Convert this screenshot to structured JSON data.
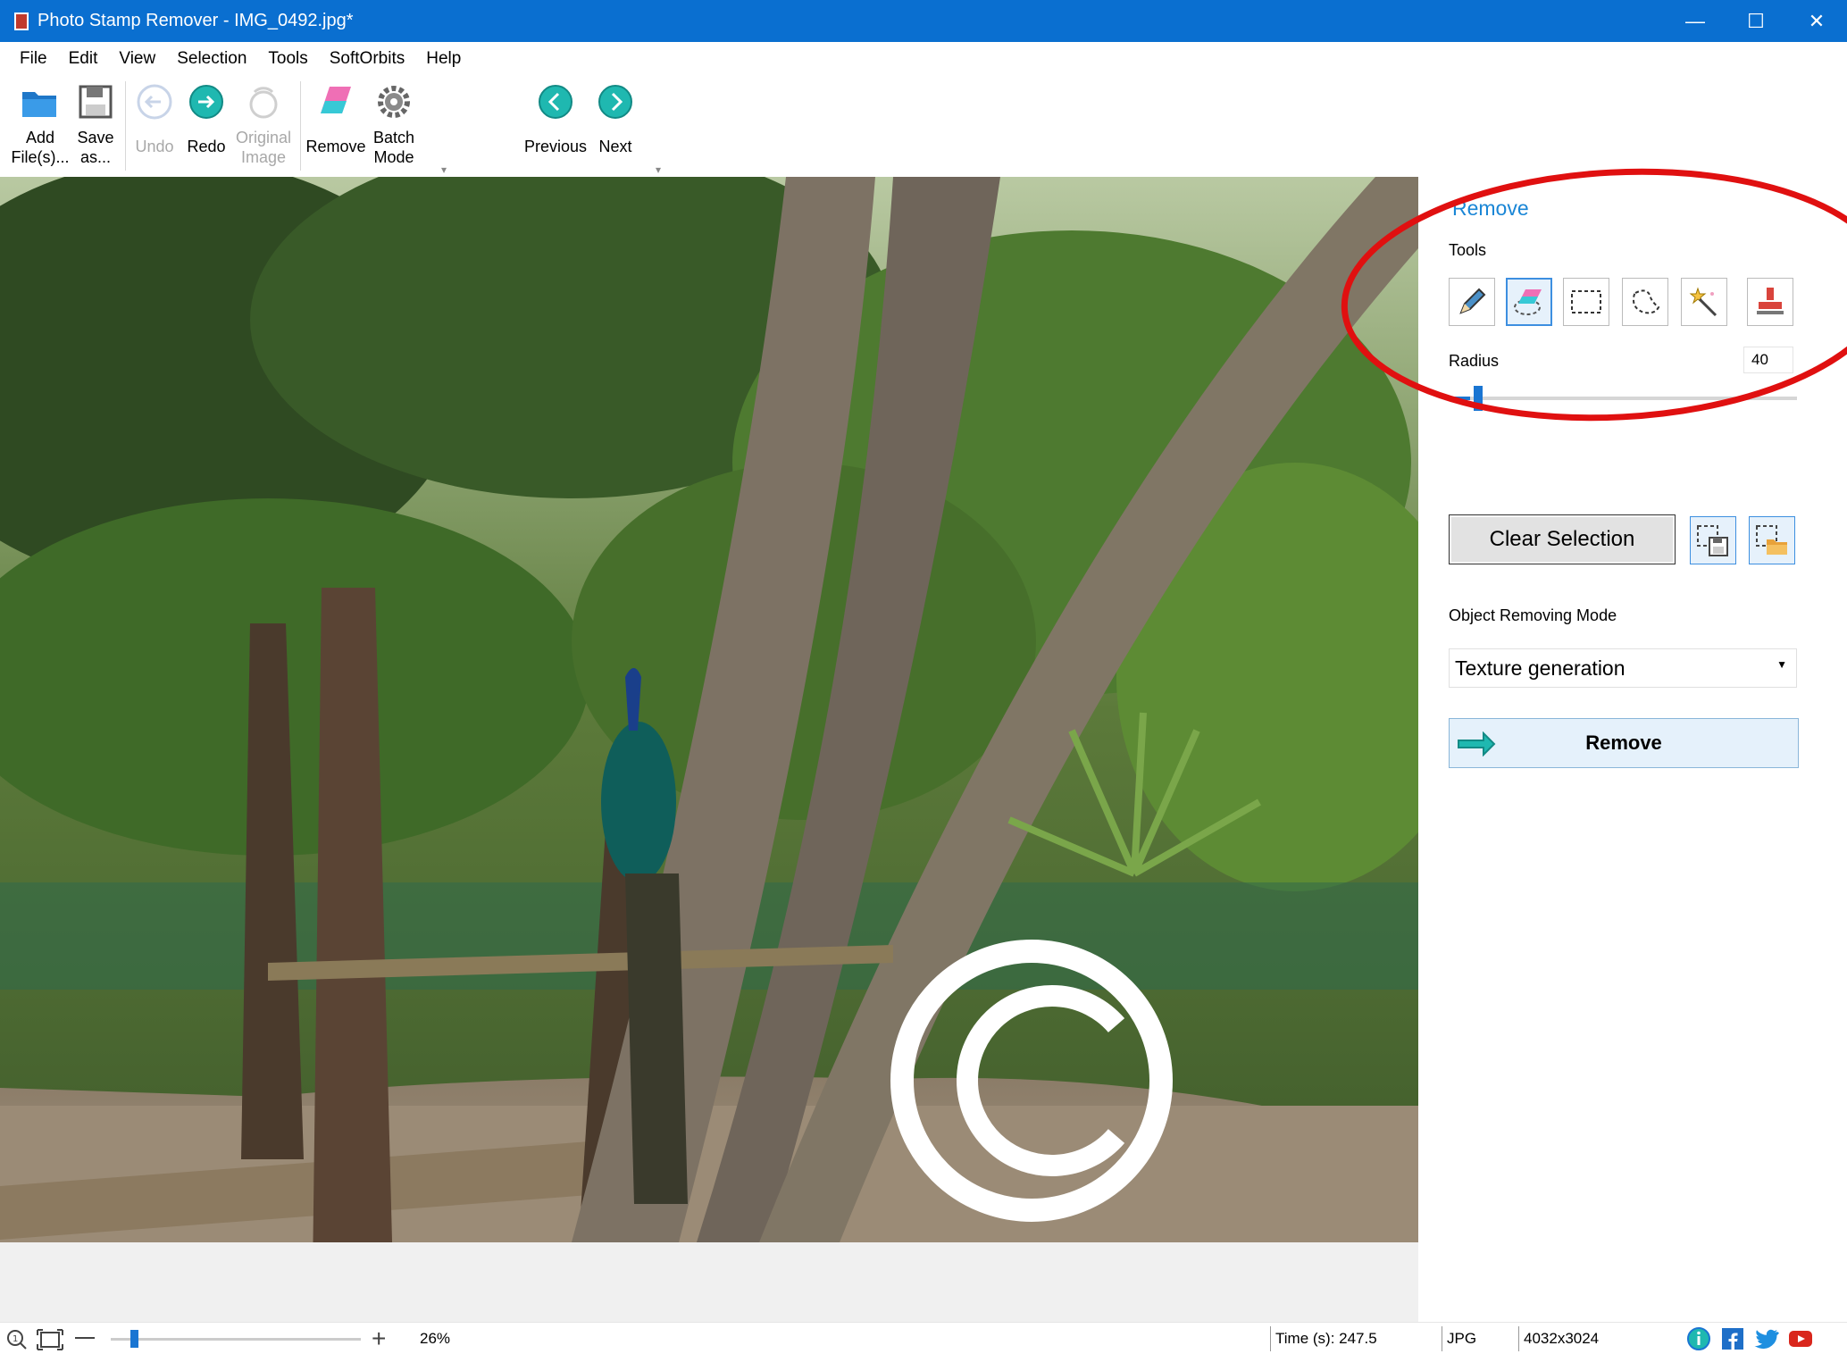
{
  "window": {
    "title": "Photo Stamp Remover - IMG_0492.jpg*",
    "minimize_glyph": "—",
    "maximize_glyph": "☐",
    "close_glyph": "✕"
  },
  "menu": [
    "File",
    "Edit",
    "View",
    "Selection",
    "Tools",
    "SoftOrbits",
    "Help"
  ],
  "toolbar": {
    "add_line1": "Add",
    "add_line2": "File(s)...",
    "save_line1": "Save",
    "save_line2": "as...",
    "undo": "Undo",
    "redo": "Redo",
    "original_line1": "Original",
    "original_line2": "Image",
    "remove": "Remove",
    "batch_line1": "Batch",
    "batch_line2": "Mode",
    "previous": "Previous",
    "next": "Next"
  },
  "panel": {
    "title": "Remove",
    "tools_label": "Tools",
    "tools": [
      "pencil-icon",
      "eraser-icon",
      "rect-select-icon",
      "lasso-icon",
      "magic-wand-icon",
      "stamp-icon"
    ],
    "active_tool": "eraser-icon",
    "radius_label": "Radius",
    "radius_value": "40",
    "clear_selection": "Clear Selection",
    "mode_label": "Object Removing Mode",
    "mode_value": "Texture generation",
    "remove_button": "Remove"
  },
  "status": {
    "zoom": "26%",
    "time": "Time (s): 247.5",
    "format": "JPG",
    "dimensions": "4032x3024"
  },
  "colors": {
    "titlebar": "#0a6fd0",
    "accent": "#1a86d6",
    "annotation": "#e01010"
  }
}
